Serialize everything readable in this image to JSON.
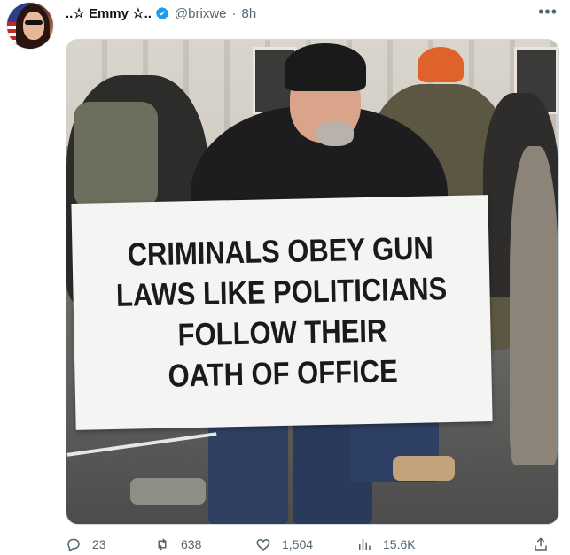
{
  "tweet": {
    "display_name": "..☆ Emmy ☆..",
    "handle": "@brixwe",
    "time": "8h",
    "verified": true
  },
  "media": {
    "sign_lines": [
      "CRIMINALS OBEY GUN",
      "LAWS LIKE POLITICIANS",
      "FOLLOW THEIR",
      "OATH OF OFFICE"
    ]
  },
  "actions": {
    "replies": "23",
    "retweets": "638",
    "likes": "1,504",
    "views": "15.6K"
  },
  "colors": {
    "verified_blue": "#1d9bf0",
    "secondary_text": "#536471"
  },
  "icons": {
    "more": "more-icon",
    "reply": "reply-icon",
    "retweet": "retweet-icon",
    "like": "like-icon",
    "views": "views-icon",
    "share": "share-icon"
  }
}
